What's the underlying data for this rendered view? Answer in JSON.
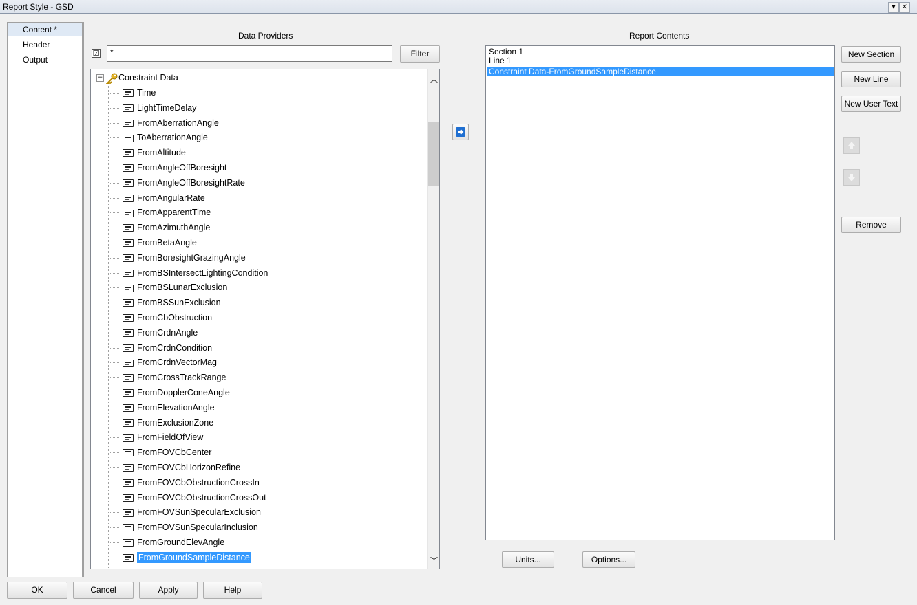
{
  "window": {
    "title": "Report Style - GSD"
  },
  "sidebar": {
    "items": [
      "Content *",
      "Header",
      "Output"
    ]
  },
  "data_providers": {
    "heading": "Data Providers",
    "filter_value": "*",
    "filter_checked": "☑",
    "filter_button": "Filter",
    "root_label": "Constraint Data",
    "items": [
      "Time",
      "LightTimeDelay",
      "FromAberrationAngle",
      "ToAberrationAngle",
      "FromAltitude",
      "FromAngleOffBoresight",
      "FromAngleOffBoresightRate",
      "FromAngularRate",
      "FromApparentTime",
      "FromAzimuthAngle",
      "FromBetaAngle",
      "FromBoresightGrazingAngle",
      "FromBSIntersectLightingCondition",
      "FromBSLunarExclusion",
      "FromBSSunExclusion",
      "FromCbObstruction",
      "FromCrdnAngle",
      "FromCrdnCondition",
      "FromCrdnVectorMag",
      "FromCrossTrackRange",
      "FromDopplerConeAngle",
      "FromElevationAngle",
      "FromExclusionZone",
      "FromFieldOfView",
      "FromFOVCbCenter",
      "FromFOVCbHorizonRefine",
      "FromFOVCbObstructionCrossIn",
      "FromFOVCbObstructionCrossOut",
      "FromFOVSunSpecularExclusion",
      "FromFOVSunSpecularInclusion",
      "FromGroundElevAngle",
      "FromGroundSampleDistance"
    ],
    "selected_item": "FromGroundSampleDistance"
  },
  "report_contents": {
    "heading": "Report Contents",
    "rows": [
      "Section 1",
      "Line 1",
      "Constraint Data-FromGroundSampleDistance"
    ],
    "selected_row": "Constraint Data-FromGroundSampleDistance"
  },
  "side_buttons": {
    "new_section": "New Section",
    "new_line": "New Line",
    "new_user_text": "New User Text",
    "remove": "Remove"
  },
  "lower_buttons": {
    "units": "Units...",
    "options": "Options..."
  },
  "footer": {
    "ok": "OK",
    "cancel": "Cancel",
    "apply": "Apply",
    "help": "Help"
  }
}
